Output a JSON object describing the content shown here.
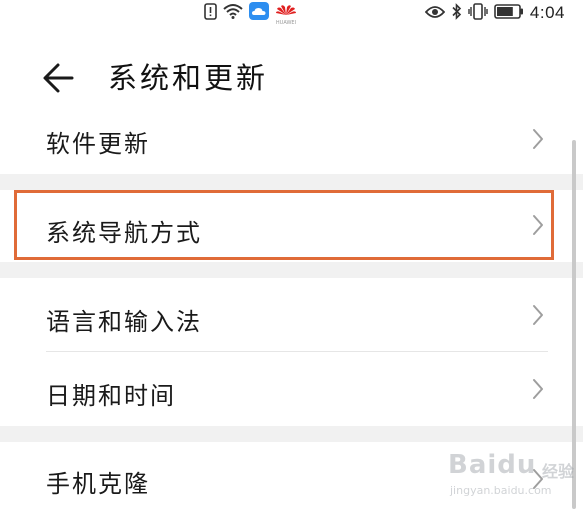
{
  "status_bar": {
    "time": "4:04",
    "brand": "HUAWEI",
    "battery_level": 0.75,
    "icons": [
      "notification-alert-icon",
      "wifi-icon",
      "cloud-icon",
      "huawei-logo-icon",
      "eye-icon",
      "bluetooth-icon",
      "vibrate-icon",
      "battery-icon"
    ]
  },
  "header": {
    "title": "系统和更新"
  },
  "list": {
    "items": [
      {
        "label": "软件更新"
      },
      {
        "label": "系统导航方式"
      },
      {
        "label": "语言和输入法"
      },
      {
        "label": "日期和时间"
      },
      {
        "label": "手机克隆"
      }
    ]
  },
  "watermark": {
    "brand": "Baidu",
    "jingyan": "经验",
    "url": "jingyan.baidu.com"
  },
  "colors": {
    "highlight": "#e06b38",
    "separator": "#f1f1f1",
    "chevron": "#9e9e9e"
  }
}
